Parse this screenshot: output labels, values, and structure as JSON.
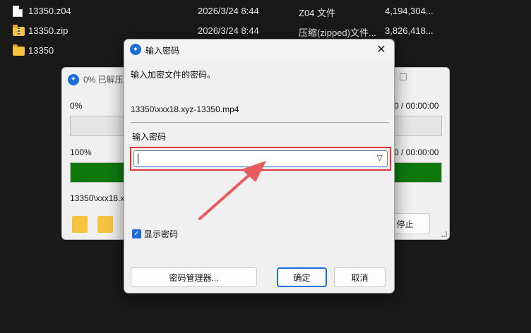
{
  "files": [
    {
      "name": "13350.z04",
      "date": "2026/3/24 8:44",
      "type": "Z04 文件",
      "size": "4,194,304...",
      "icon": "file-icon"
    },
    {
      "name": "13350.zip",
      "date": "2026/3/24 8:44",
      "type": "压缩(zipped)文件...",
      "size": "3,826,418...",
      "icon": "zip-folder-icon"
    },
    {
      "name": "13350",
      "date": "",
      "type": "",
      "size": "",
      "icon": "folder-icon"
    }
  ],
  "progress_window": {
    "title": "0% 已解压",
    "progress1_label": "0%",
    "progress1_time": "0 / 00:00:00",
    "progress1_value": 0,
    "progress2_label": "100%",
    "progress2_time": "0 / 00:00:00",
    "progress2_value": 1,
    "current_file": "13350\\xxx18.x",
    "stop_label": "停止"
  },
  "password_dialog": {
    "title": "输入密码",
    "instruction": "输入加密文件的密码。",
    "file_path": "13350\\xxx18.xyz-13350.mp4",
    "password_label": "输入密码",
    "password_value": "",
    "show_password_label": "显示密码",
    "show_password_checked": true,
    "manager_button": "密码管理器...",
    "ok_button": "确定",
    "cancel_button": "取消"
  },
  "colors": {
    "background": "#191919",
    "dialog": "#f0f0f0",
    "accent": "#1b6ed8",
    "highlight_box": "#e0373b",
    "arrow": "#e85a5e",
    "progress_fill": "#0e7a0e"
  }
}
